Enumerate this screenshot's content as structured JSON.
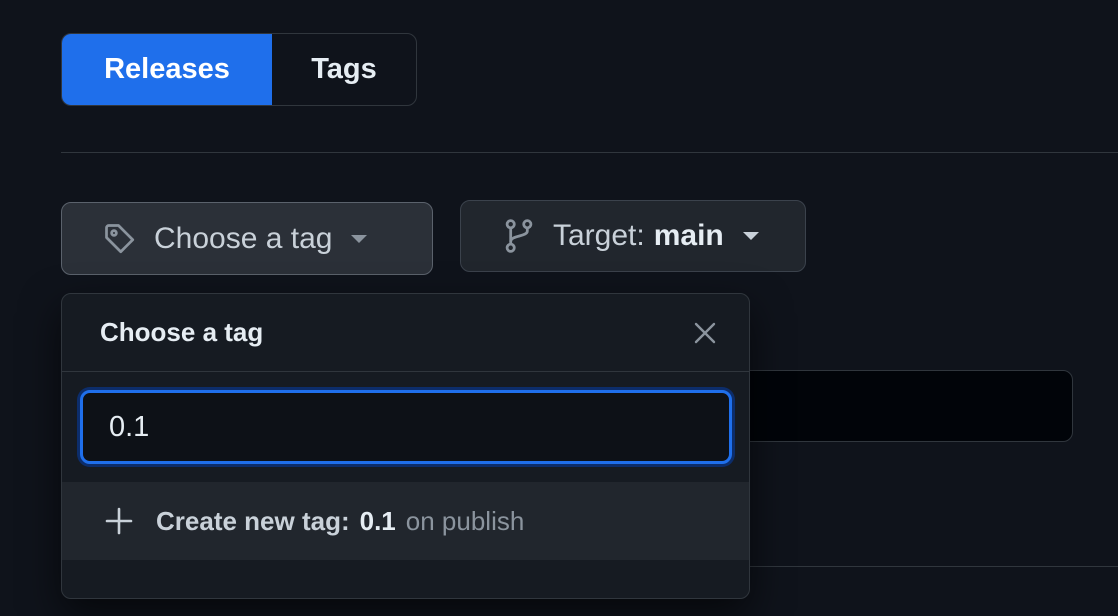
{
  "tabs": [
    {
      "label": "Releases",
      "active": true
    },
    {
      "label": "Tags",
      "active": false
    }
  ],
  "tag_button": {
    "label": "Choose a tag",
    "icon": "tag-icon"
  },
  "target_button": {
    "prefix": "Target:",
    "branch": "main",
    "icon": "git-branch-icon"
  },
  "dropdown": {
    "title": "Choose a tag",
    "search_value": "0.1",
    "create": {
      "label": "Create new tag:",
      "value": "0.1",
      "suffix": "on publish"
    }
  },
  "colors": {
    "accent": "#1f6feb",
    "background": "#0f131b",
    "panel": "#161b22"
  }
}
